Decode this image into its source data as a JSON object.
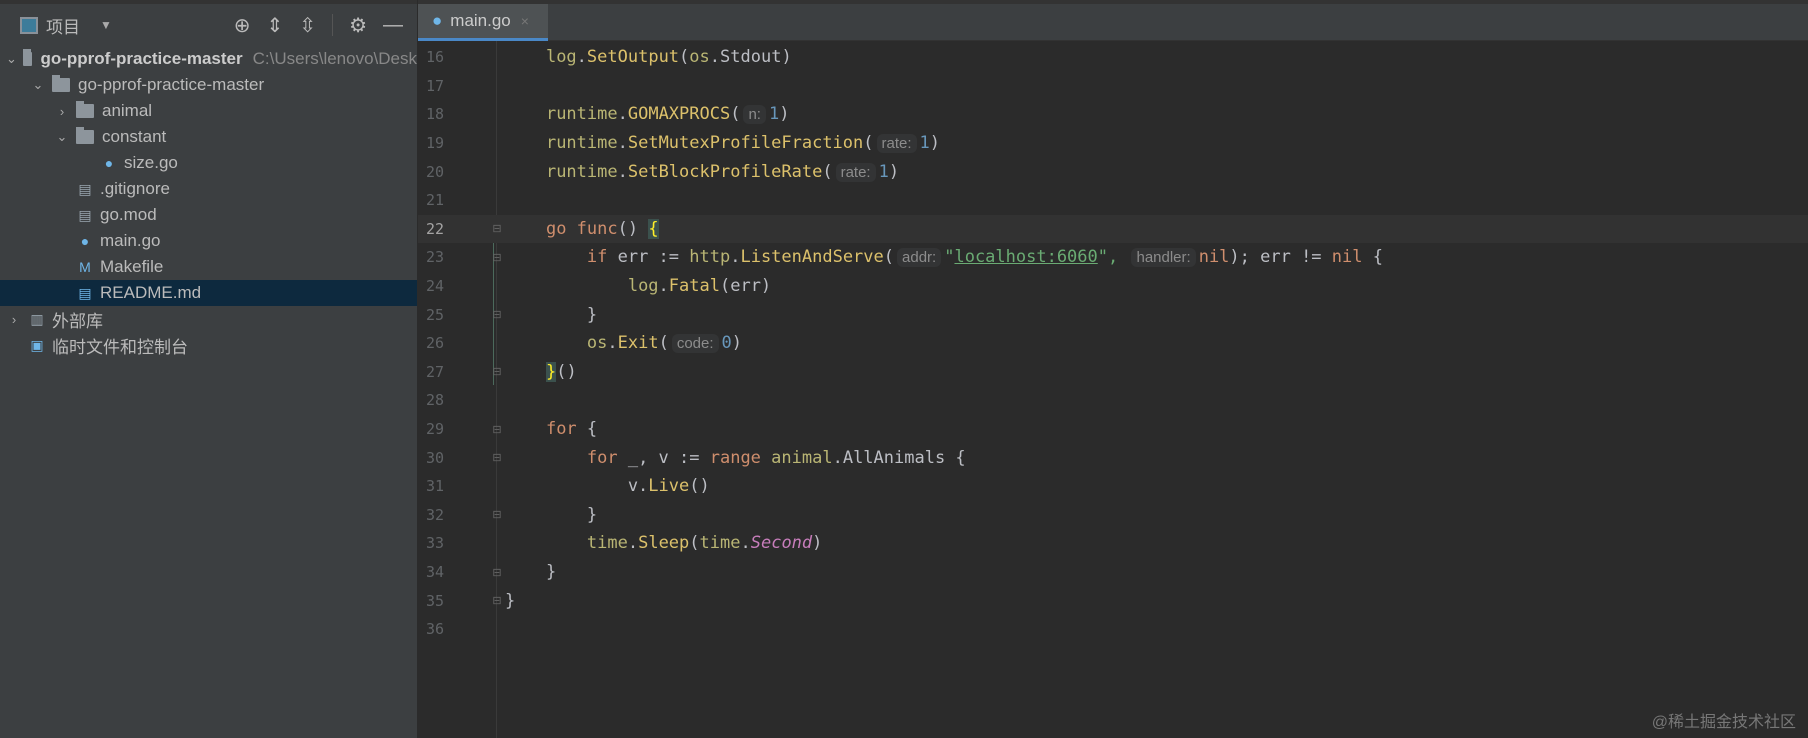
{
  "left_panel": {
    "title": "项目",
    "tree": [
      {
        "label": "go-pprof-practice-master",
        "path": "C:\\Users\\lenovo\\Desk",
        "depth": 0,
        "chev": "v",
        "icon": "folder",
        "bold": true
      },
      {
        "label": "go-pprof-practice-master",
        "depth": 1,
        "chev": "v",
        "icon": "folder"
      },
      {
        "label": "animal",
        "depth": 2,
        "chev": ">",
        "icon": "folder"
      },
      {
        "label": "constant",
        "depth": 2,
        "chev": "v",
        "icon": "folder"
      },
      {
        "label": "size.go",
        "depth": 3,
        "icon": "go-file"
      },
      {
        "label": ".gitignore",
        "depth": 2,
        "icon": "ignore-file"
      },
      {
        "label": "go.mod",
        "depth": 2,
        "icon": "mod-file"
      },
      {
        "label": "main.go",
        "depth": 2,
        "icon": "go-file"
      },
      {
        "label": "Makefile",
        "depth": 2,
        "icon": "makefile"
      },
      {
        "label": "README.md",
        "depth": 2,
        "icon": "markdown-file",
        "selected": true
      },
      {
        "label": "外部库",
        "depth": 0,
        "chev": ">",
        "icon": "library"
      },
      {
        "label": "临时文件和控制台",
        "depth": 0,
        "icon": "scratch"
      }
    ]
  },
  "tab": {
    "label": "main.go",
    "close": "×"
  },
  "editor": {
    "current_line": 22,
    "lines": [
      {
        "n": "16",
        "t": [
          [
            "    ",
            ""
          ],
          [
            "log",
            "pkg"
          ],
          [
            ".",
            ""
          ],
          [
            "SetOutput",
            "fn"
          ],
          [
            "(",
            ""
          ],
          [
            "os",
            "pkg"
          ],
          [
            ".",
            ""
          ],
          [
            "Stdout",
            "id"
          ],
          [
            ")",
            ""
          ]
        ]
      },
      {
        "n": "17",
        "t": []
      },
      {
        "n": "18",
        "t": [
          [
            "    ",
            ""
          ],
          [
            "runtime",
            "pkg"
          ],
          [
            ".",
            ""
          ],
          [
            "GOMAXPROCS",
            "fn"
          ],
          [
            "(",
            ""
          ],
          [
            "n:",
            "hint"
          ],
          [
            "1",
            "num"
          ],
          [
            ")",
            ""
          ]
        ]
      },
      {
        "n": "19",
        "t": [
          [
            "    ",
            ""
          ],
          [
            "runtime",
            "pkg"
          ],
          [
            ".",
            ""
          ],
          [
            "SetMutexProfileFraction",
            "fn"
          ],
          [
            "(",
            ""
          ],
          [
            "rate:",
            "hint"
          ],
          [
            "1",
            "num"
          ],
          [
            ")",
            ""
          ]
        ]
      },
      {
        "n": "20",
        "t": [
          [
            "    ",
            ""
          ],
          [
            "runtime",
            "pkg"
          ],
          [
            ".",
            ""
          ],
          [
            "SetBlockProfileRate",
            "fn"
          ],
          [
            "(",
            ""
          ],
          [
            "rate:",
            "hint"
          ],
          [
            "1",
            "num"
          ],
          [
            ")",
            ""
          ]
        ]
      },
      {
        "n": "21",
        "t": []
      },
      {
        "n": "22",
        "t": [
          [
            "    ",
            ""
          ],
          [
            "go ",
            "kw"
          ],
          [
            "func",
            "kw"
          ],
          [
            "() ",
            ""
          ],
          [
            "{",
            "brace"
          ]
        ],
        "fold": "open"
      },
      {
        "n": "23",
        "t": [
          [
            "        ",
            ""
          ],
          [
            "if ",
            "kw"
          ],
          [
            "err := ",
            ""
          ],
          [
            "http",
            "pkg"
          ],
          [
            ".",
            ""
          ],
          [
            "ListenAndServe",
            "fn"
          ],
          [
            "(",
            ""
          ],
          [
            "addr:",
            "hint"
          ],
          [
            "\"",
            "str2"
          ],
          [
            "localhost:6060",
            "str"
          ],
          [
            "\", ",
            "str2"
          ],
          [
            "handler:",
            "hint"
          ],
          [
            "nil",
            "kw"
          ],
          [
            "); err != ",
            ""
          ],
          [
            "nil",
            "kw"
          ],
          [
            " {",
            ""
          ]
        ],
        "fold": "open"
      },
      {
        "n": "24",
        "t": [
          [
            "            ",
            ""
          ],
          [
            "log",
            "pkg"
          ],
          [
            ".",
            ""
          ],
          [
            "Fatal",
            "fn"
          ],
          [
            "(err)",
            ""
          ]
        ]
      },
      {
        "n": "25",
        "t": [
          [
            "        }",
            ""
          ]
        ],
        "fold": "close"
      },
      {
        "n": "26",
        "t": [
          [
            "        ",
            ""
          ],
          [
            "os",
            "pkg"
          ],
          [
            ".",
            ""
          ],
          [
            "Exit",
            "fn"
          ],
          [
            "(",
            ""
          ],
          [
            "code:",
            "hint"
          ],
          [
            "0",
            "num"
          ],
          [
            ")",
            ""
          ]
        ]
      },
      {
        "n": "27",
        "t": [
          [
            "    ",
            ""
          ],
          [
            "}",
            "brace"
          ],
          [
            "()",
            ""
          ]
        ],
        "fold": "close"
      },
      {
        "n": "28",
        "t": []
      },
      {
        "n": "29",
        "t": [
          [
            "    ",
            ""
          ],
          [
            "for ",
            "kw"
          ],
          [
            "{",
            ""
          ]
        ],
        "fold": "open"
      },
      {
        "n": "30",
        "t": [
          [
            "        ",
            ""
          ],
          [
            "for ",
            "kw"
          ],
          [
            "_, v := ",
            ""
          ],
          [
            "range ",
            "kw"
          ],
          [
            "animal",
            "pkg"
          ],
          [
            ".",
            ""
          ],
          [
            "AllAnimals",
            ""
          ],
          [
            " {",
            ""
          ]
        ],
        "fold": "open"
      },
      {
        "n": "31",
        "t": [
          [
            "            v.",
            ""
          ],
          [
            "Live",
            "fn"
          ],
          [
            "()",
            ""
          ]
        ]
      },
      {
        "n": "32",
        "t": [
          [
            "        }",
            ""
          ]
        ],
        "fold": "close"
      },
      {
        "n": "33",
        "t": [
          [
            "        ",
            ""
          ],
          [
            "time",
            "pkg"
          ],
          [
            ".",
            ""
          ],
          [
            "Sleep",
            "fn"
          ],
          [
            "(",
            ""
          ],
          [
            "time",
            "pkg"
          ],
          [
            ".",
            ""
          ],
          [
            "Second",
            "ital"
          ],
          [
            ")",
            ""
          ]
        ]
      },
      {
        "n": "34",
        "t": [
          [
            "    }",
            ""
          ]
        ],
        "fold": "close"
      },
      {
        "n": "35",
        "t": [
          [
            "}",
            ""
          ]
        ],
        "fold": "close"
      },
      {
        "n": "36",
        "t": []
      }
    ]
  },
  "watermark": "@稀土掘金技术社区"
}
